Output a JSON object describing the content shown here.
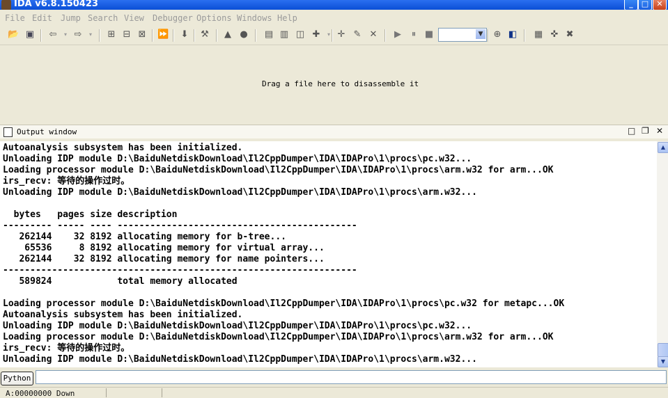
{
  "window": {
    "title": "IDA v6.8.150423",
    "minimize_glyph": "_",
    "maximize_glyph": "□",
    "close_glyph": "✕"
  },
  "menu": [
    "File",
    "Edit",
    "Jump",
    "Search",
    "View",
    "Debugger",
    "Options",
    "Windows",
    "Help"
  ],
  "main": {
    "drop_hint": "Drag a file here to disassemble it"
  },
  "output_window": {
    "title": "Output window",
    "lines": [
      "Autoanalysis subsystem has been initialized.",
      "Unloading IDP module D:\\BaiduNetdiskDownload\\Il2CppDumper\\IDA\\IDAPro\\1\\procs\\pc.w32...",
      "Loading processor module D:\\BaiduNetdiskDownload\\Il2CppDumper\\IDA\\IDAPro\\1\\procs\\arm.w32 for arm...OK",
      "irs_recv: 等待的操作过时。",
      "Unloading IDP module D:\\BaiduNetdiskDownload\\Il2CppDumper\\IDA\\IDAPro\\1\\procs\\arm.w32...",
      "",
      "  bytes   pages size description",
      "--------- ----- ---- --------------------------------------------",
      "   262144    32 8192 allocating memory for b-tree...",
      "    65536     8 8192 allocating memory for virtual array...",
      "   262144    32 8192 allocating memory for name pointers...",
      "-----------------------------------------------------------------",
      "   589824            total memory allocated",
      "",
      "Loading processor module D:\\BaiduNetdiskDownload\\Il2CppDumper\\IDA\\IDAPro\\1\\procs\\pc.w32 for metapc...OK",
      "Autoanalysis subsystem has been initialized.",
      "Unloading IDP module D:\\BaiduNetdiskDownload\\Il2CppDumper\\IDA\\IDAPro\\1\\procs\\pc.w32...",
      "Loading processor module D:\\BaiduNetdiskDownload\\Il2CppDumper\\IDA\\IDAPro\\1\\procs\\arm.w32 for arm...OK",
      "irs_recv: 等待的操作过时。",
      "Unloading IDP module D:\\BaiduNetdiskDownload\\Il2CppDumper\\IDA\\IDAPro\\1\\procs\\arm.w32..."
    ]
  },
  "python_bar": {
    "button_label": "Python",
    "input_value": ""
  },
  "status_bar": {
    "text": "A:00000000 Down"
  },
  "icons": {
    "open": "open-folder-icon",
    "save": "save-icon",
    "back": "back-arrow-icon",
    "forward": "forward-arrow-icon",
    "run": "run-icon",
    "pause": "pause-icon",
    "stop": "stop-icon"
  },
  "colors": {
    "titlebar": "#0b4fd6",
    "face": "#ece9d8",
    "log_background": "#ffffff"
  }
}
